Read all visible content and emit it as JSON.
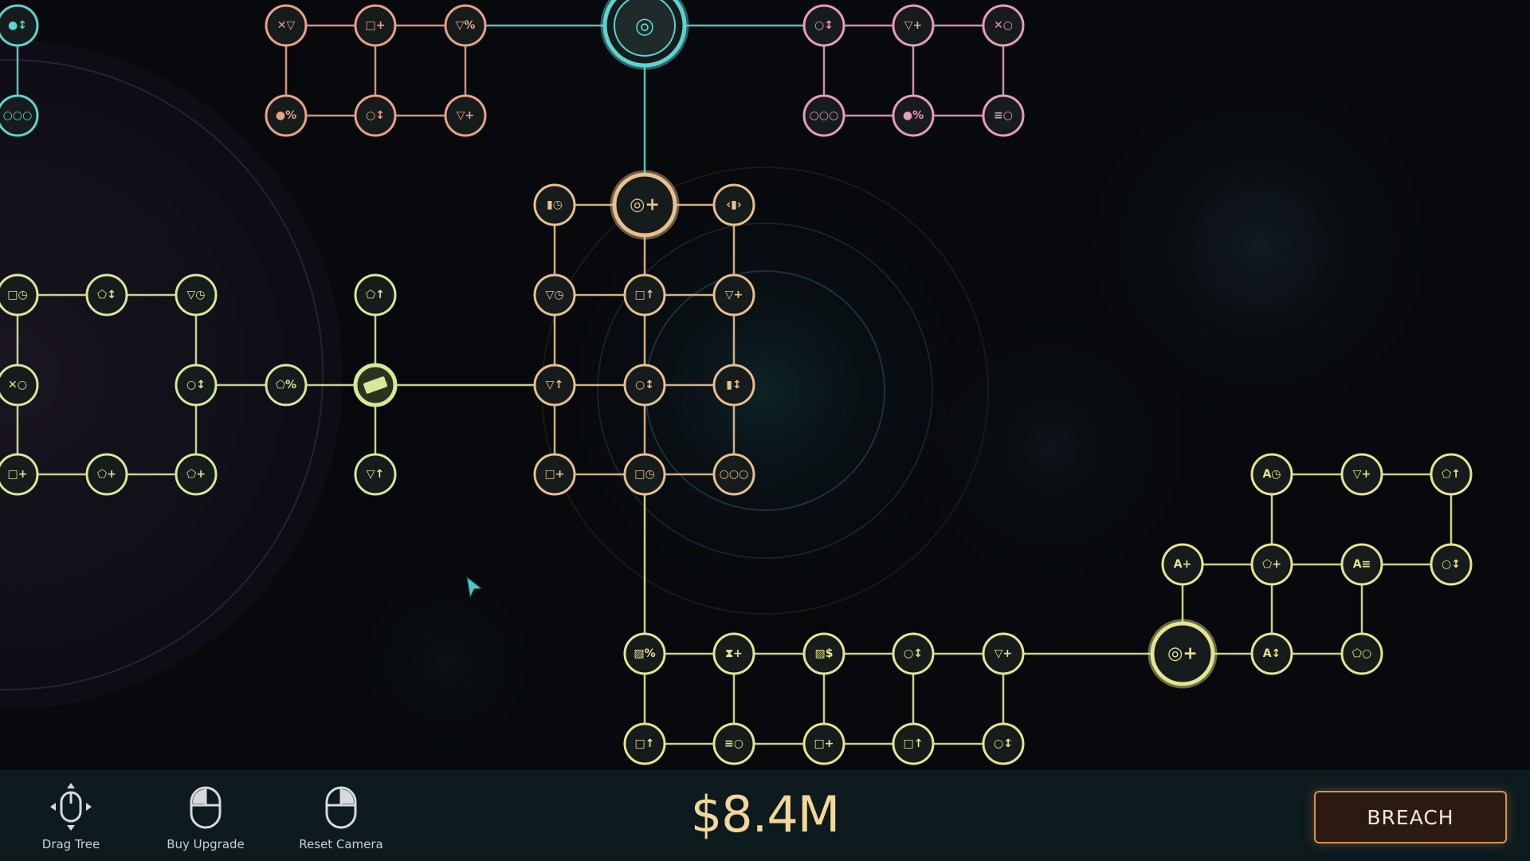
{
  "controls": [
    {
      "name": "drag-tree",
      "label": "Drag Tree",
      "icon": "mouse-move-icon"
    },
    {
      "name": "buy-upgrade",
      "label": "Buy Upgrade",
      "icon": "mouse-left-click-icon"
    },
    {
      "name": "reset-camera",
      "label": "Reset Camera",
      "icon": "mouse-right-click-icon"
    }
  ],
  "money": "$8.4M",
  "breach_label": "BREACH",
  "colors": {
    "cyan": "#5fd3d0",
    "pink": "#e79bbd",
    "salmon": "#eaa189",
    "orange": "#e9c08e",
    "lime": "#d6e89a",
    "gold": "#e6e58f",
    "node_fill": "#161c1c",
    "money": "#f1d79a",
    "breach_border": "#d39452"
  },
  "upgrade_tree": {
    "nodes": [
      {
        "id": "a1",
        "glyph": "●↕",
        "color": "cyan"
      },
      {
        "id": "a2",
        "glyph": "○○○",
        "color": "cyan"
      },
      {
        "id": "b1",
        "glyph": "✕▽",
        "color": "salmon"
      },
      {
        "id": "b2",
        "glyph": "□+",
        "color": "salmon"
      },
      {
        "id": "b3",
        "glyph": "▽%",
        "color": "salmon"
      },
      {
        "id": "b4",
        "glyph": "●%",
        "color": "salmon"
      },
      {
        "id": "b5",
        "glyph": "○↕",
        "color": "salmon"
      },
      {
        "id": "b6",
        "glyph": "▽+",
        "color": "salmon"
      },
      {
        "id": "core",
        "glyph": "◎",
        "color": "cyan",
        "type": "core"
      },
      {
        "id": "c1",
        "glyph": "○↕",
        "color": "pink"
      },
      {
        "id": "c2",
        "glyph": "▽+",
        "color": "pink"
      },
      {
        "id": "c3",
        "glyph": "✕○",
        "color": "pink"
      },
      {
        "id": "c4",
        "glyph": "○○○",
        "color": "pink"
      },
      {
        "id": "c5",
        "glyph": "●%",
        "color": "pink"
      },
      {
        "id": "c6",
        "glyph": "≡○",
        "color": "pink"
      },
      {
        "id": "hub-orange",
        "glyph": "◎+",
        "color": "orange",
        "type": "hub"
      },
      {
        "id": "d1",
        "glyph": "▮◷",
        "color": "orange"
      },
      {
        "id": "d2",
        "glyph": "‹▮›",
        "color": "orange"
      },
      {
        "id": "d3",
        "glyph": "▽◷",
        "color": "orange"
      },
      {
        "id": "d4",
        "glyph": "□↑",
        "color": "orange"
      },
      {
        "id": "d5",
        "glyph": "▽+",
        "color": "orange"
      },
      {
        "id": "d6",
        "glyph": "▽↑",
        "color": "orange"
      },
      {
        "id": "d7",
        "glyph": "○↕",
        "color": "orange"
      },
      {
        "id": "d8",
        "glyph": "▮↕",
        "color": "orange"
      },
      {
        "id": "d9",
        "glyph": "□+",
        "color": "orange"
      },
      {
        "id": "d10",
        "glyph": "□◷",
        "color": "orange"
      },
      {
        "id": "d11",
        "glyph": "○○○",
        "color": "orange"
      },
      {
        "id": "e1",
        "glyph": "□◷",
        "color": "lime"
      },
      {
        "id": "e2",
        "glyph": "⬠↕",
        "color": "lime"
      },
      {
        "id": "e3",
        "glyph": "▽◷",
        "color": "lime"
      },
      {
        "id": "e4",
        "glyph": "⬠↑",
        "color": "lime"
      },
      {
        "id": "e5",
        "glyph": "✕○",
        "color": "lime"
      },
      {
        "id": "e6",
        "glyph": "○↕",
        "color": "lime"
      },
      {
        "id": "e7",
        "glyph": "⬠%",
        "color": "lime"
      },
      {
        "id": "hub-lime",
        "glyph": "▬",
        "color": "lime",
        "type": "key"
      },
      {
        "id": "e8",
        "glyph": "□+",
        "color": "lime"
      },
      {
        "id": "e9",
        "glyph": "⬠+",
        "color": "lime"
      },
      {
        "id": "e10",
        "glyph": "⬠+",
        "color": "lime"
      },
      {
        "id": "e11",
        "glyph": "▽↑",
        "color": "lime"
      },
      {
        "id": "f1",
        "glyph": "▨%",
        "color": "gold"
      },
      {
        "id": "f2",
        "glyph": "⧗+",
        "color": "gold"
      },
      {
        "id": "f3",
        "glyph": "▨$",
        "color": "gold"
      },
      {
        "id": "f4",
        "glyph": "○↕",
        "color": "gold"
      },
      {
        "id": "f5",
        "glyph": "▽+",
        "color": "gold"
      },
      {
        "id": "f6",
        "glyph": "□↑",
        "color": "gold"
      },
      {
        "id": "f7",
        "glyph": "≡○",
        "color": "gold"
      },
      {
        "id": "f8",
        "glyph": "□+",
        "color": "gold"
      },
      {
        "id": "f9",
        "glyph": "□↑",
        "color": "gold"
      },
      {
        "id": "f10",
        "glyph": "○↕",
        "color": "gold"
      },
      {
        "id": "hub-gold",
        "glyph": "◎+",
        "color": "gold",
        "type": "hub"
      },
      {
        "id": "g1",
        "glyph": "A◷",
        "color": "gold"
      },
      {
        "id": "g2",
        "glyph": "▽+",
        "color": "gold"
      },
      {
        "id": "g3",
        "glyph": "⬠↑",
        "color": "gold"
      },
      {
        "id": "g4",
        "glyph": "A+",
        "color": "gold"
      },
      {
        "id": "g5",
        "glyph": "⬠+",
        "color": "gold"
      },
      {
        "id": "g6",
        "glyph": "A≡",
        "color": "gold"
      },
      {
        "id": "g7",
        "glyph": "○↕",
        "color": "gold"
      },
      {
        "id": "g8",
        "glyph": "A↕",
        "color": "gold"
      },
      {
        "id": "g9",
        "glyph": "⬠○",
        "color": "gold"
      }
    ],
    "edges": [
      [
        "a1",
        "a2",
        "cyan"
      ],
      [
        "b1",
        "b2",
        "salmon"
      ],
      [
        "b2",
        "b3",
        "salmon"
      ],
      [
        "b4",
        "b5",
        "salmon"
      ],
      [
        "b5",
        "b6",
        "salmon"
      ],
      [
        "b1",
        "b4",
        "salmon"
      ],
      [
        "b2",
        "b5",
        "salmon"
      ],
      [
        "b3",
        "b6",
        "salmon"
      ],
      [
        "b3",
        "core",
        "cyan"
      ],
      [
        "core",
        "c1",
        "cyan"
      ],
      [
        "c1",
        "c2",
        "pink"
      ],
      [
        "c2",
        "c3",
        "pink"
      ],
      [
        "c4",
        "c5",
        "pink"
      ],
      [
        "c5",
        "c6",
        "pink"
      ],
      [
        "c1",
        "c4",
        "pink"
      ],
      [
        "c2",
        "c5",
        "pink"
      ],
      [
        "c3",
        "c6",
        "pink"
      ],
      [
        "core",
        "hub-orange",
        "cyan"
      ],
      [
        "d1",
        "hub-orange",
        "orange"
      ],
      [
        "hub-orange",
        "d2",
        "orange"
      ],
      [
        "d3",
        "d4",
        "orange"
      ],
      [
        "d4",
        "d5",
        "orange"
      ],
      [
        "d6",
        "d7",
        "orange"
      ],
      [
        "d7",
        "d8",
        "orange"
      ],
      [
        "d9",
        "d10",
        "orange"
      ],
      [
        "d10",
        "d11",
        "orange"
      ],
      [
        "d1",
        "d3",
        "orange"
      ],
      [
        "d3",
        "d6",
        "orange"
      ],
      [
        "d6",
        "d9",
        "orange"
      ],
      [
        "hub-orange",
        "d4",
        "orange"
      ],
      [
        "d4",
        "d7",
        "orange"
      ],
      [
        "d7",
        "d10",
        "orange"
      ],
      [
        "d2",
        "d5",
        "orange"
      ],
      [
        "d5",
        "d8",
        "orange"
      ],
      [
        "d8",
        "d11",
        "orange"
      ],
      [
        "e1",
        "e2",
        "lime"
      ],
      [
        "e2",
        "e3",
        "lime"
      ],
      [
        "e3",
        "e6",
        "lime"
      ],
      [
        "e1",
        "e5",
        "lime"
      ],
      [
        "e5",
        "e8",
        "lime"
      ],
      [
        "e8",
        "e9",
        "lime"
      ],
      [
        "e9",
        "e10",
        "lime"
      ],
      [
        "e10",
        "e6",
        "lime"
      ],
      [
        "e6",
        "e7",
        "lime"
      ],
      [
        "e7",
        "hub-lime",
        "lime"
      ],
      [
        "e4",
        "hub-lime",
        "lime"
      ],
      [
        "hub-lime",
        "e11",
        "lime"
      ],
      [
        "hub-lime",
        "d6",
        "lime"
      ],
      [
        "d10",
        "f1",
        "gold"
      ],
      [
        "f1",
        "f2",
        "gold"
      ],
      [
        "f2",
        "f3",
        "gold"
      ],
      [
        "f3",
        "f4",
        "gold"
      ],
      [
        "f4",
        "f5",
        "gold"
      ],
      [
        "f5",
        "hub-gold",
        "gold"
      ],
      [
        "f1",
        "f6",
        "gold"
      ],
      [
        "f6",
        "f7",
        "gold"
      ],
      [
        "f7",
        "f8",
        "gold"
      ],
      [
        "f8",
        "f9",
        "gold"
      ],
      [
        "f9",
        "f10",
        "gold"
      ],
      [
        "f2",
        "f7",
        "gold"
      ],
      [
        "f3",
        "f8",
        "gold"
      ],
      [
        "f4",
        "f9",
        "gold"
      ],
      [
        "f5",
        "f10",
        "gold"
      ],
      [
        "hub-gold",
        "g8",
        "gold"
      ],
      [
        "g8",
        "g9",
        "gold"
      ],
      [
        "hub-gold",
        "g4",
        "gold"
      ],
      [
        "g4",
        "g5",
        "gold"
      ],
      [
        "g5",
        "g6",
        "gold"
      ],
      [
        "g6",
        "g7",
        "gold"
      ],
      [
        "g1",
        "g2",
        "gold"
      ],
      [
        "g2",
        "g3",
        "gold"
      ],
      [
        "g1",
        "g5",
        "gold"
      ],
      [
        "g5",
        "g8",
        "gold"
      ],
      [
        "g6",
        "g9",
        "gold"
      ],
      [
        "g3",
        "g7",
        "gold"
      ]
    ]
  }
}
